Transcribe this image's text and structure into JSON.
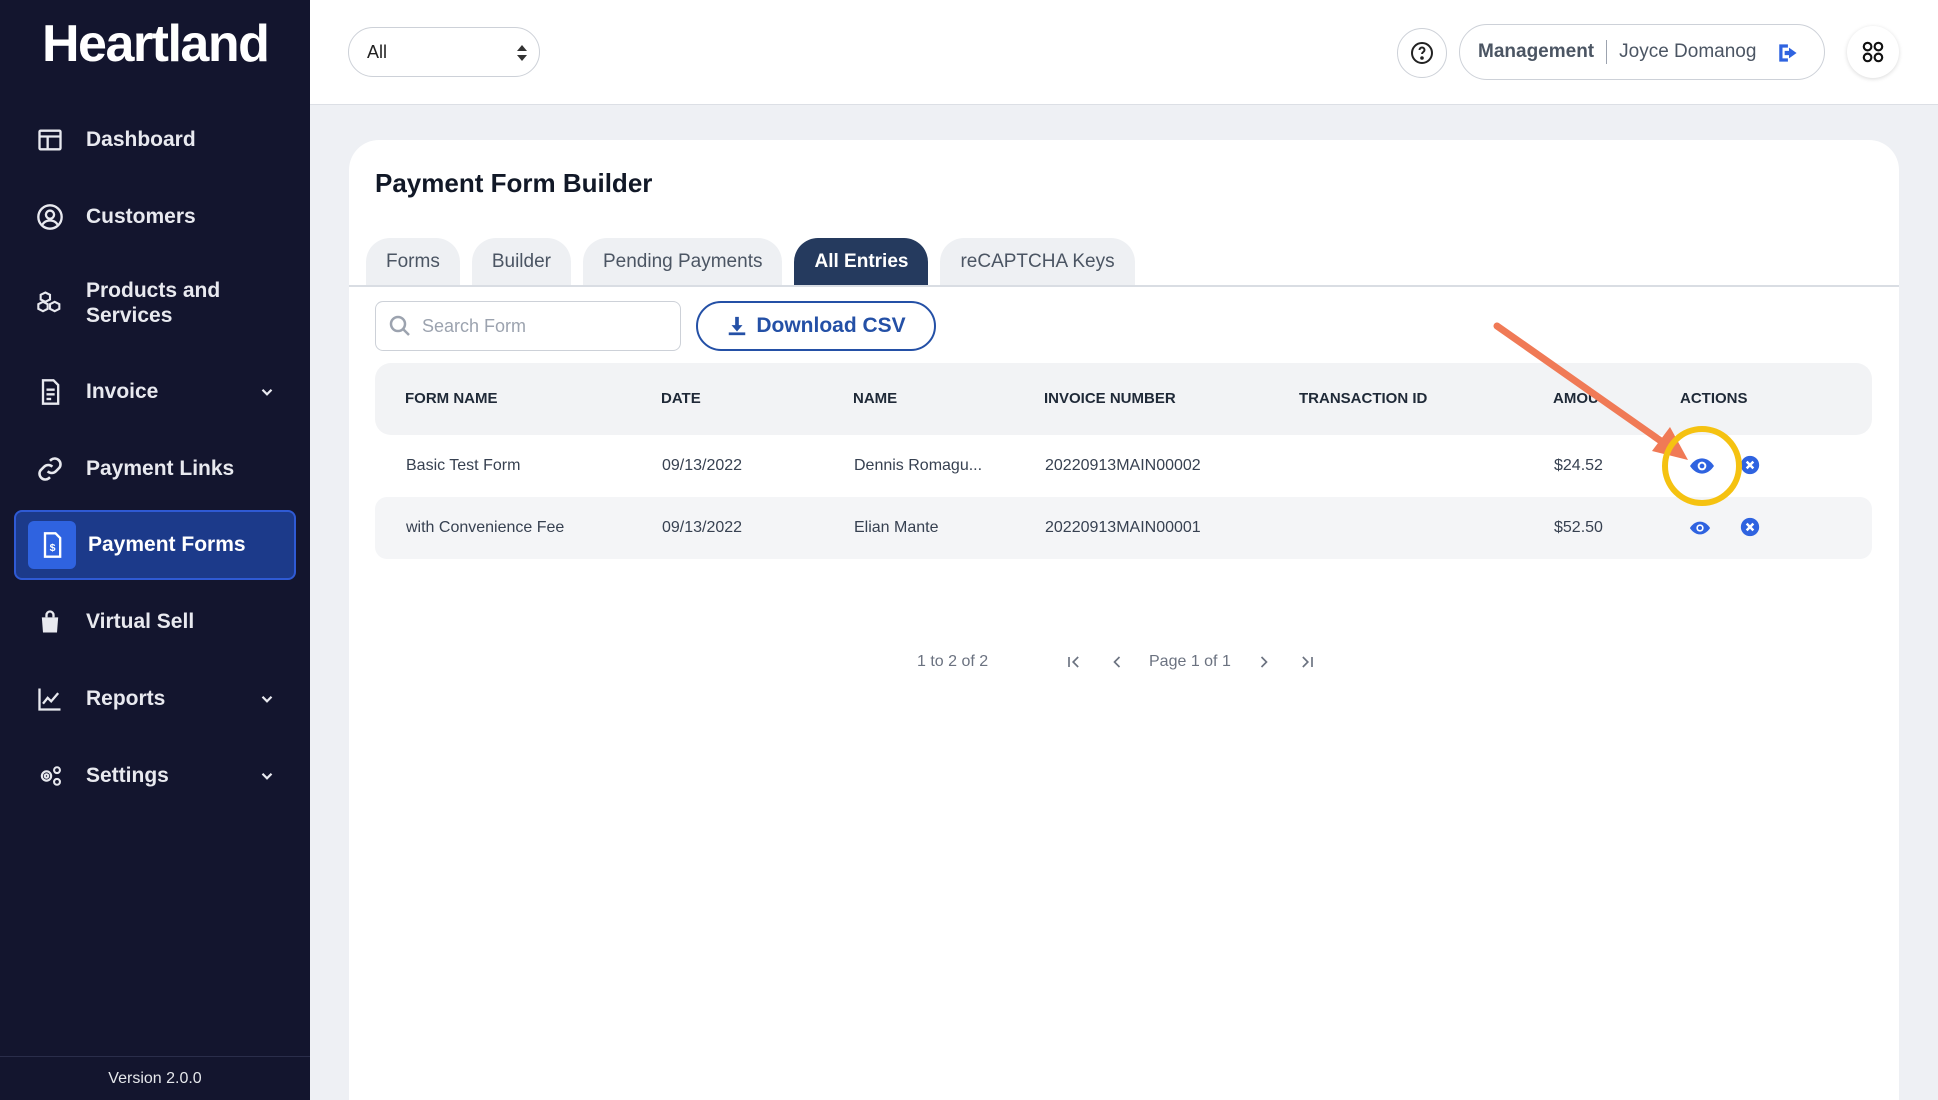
{
  "brand": "Heartland",
  "sidebar": {
    "items": [
      {
        "label": "Dashboard",
        "icon": "dashboard-icon"
      },
      {
        "label": "Customers",
        "icon": "user-circle-icon"
      },
      {
        "label": "Products and Services",
        "icon": "boxes-icon"
      },
      {
        "label": "Invoice",
        "icon": "invoice-icon"
      },
      {
        "label": "Payment Links",
        "icon": "link-icon"
      },
      {
        "label": "Payment Forms",
        "icon": "payment-form-icon"
      },
      {
        "label": "Virtual Sell",
        "icon": "shopping-bag-icon"
      },
      {
        "label": "Reports",
        "icon": "chart-line-icon"
      },
      {
        "label": "Settings",
        "icon": "gears-icon"
      }
    ],
    "version": "Version 2.0.0"
  },
  "topbar": {
    "filter_value": "All",
    "role": "Management",
    "user_name": "Joyce Domanog"
  },
  "page": {
    "title": "Payment Form Builder",
    "tabs": [
      "Forms",
      "Builder",
      "Pending Payments",
      "All Entries",
      "reCAPTCHA Keys"
    ],
    "active_tab": "All Entries",
    "search_placeholder": "Search Form",
    "download_label": "Download CSV"
  },
  "table": {
    "headers": [
      "FORM NAME",
      "DATE",
      "NAME",
      "INVOICE NUMBER",
      "TRANSACTION ID",
      "AMOU",
      "ACTIONS"
    ],
    "rows": [
      {
        "form_name": "Basic Test Form",
        "date": "09/13/2022",
        "name": "Dennis Romagu...",
        "invoice": "20220913MAIN00002",
        "transaction": "",
        "amount": "$24.52"
      },
      {
        "form_name": "with Convenience Fee",
        "date": "09/13/2022",
        "name": "Elian Mante",
        "invoice": "20220913MAIN00001",
        "transaction": "",
        "amount": "$52.50"
      }
    ]
  },
  "pager": {
    "info": "1 to 2 of 2",
    "page": "Page 1 of 1"
  },
  "colors": {
    "sidebar_bg": "#13152e",
    "active_nav": "#1c3a8a",
    "accent_blue": "#2450a6",
    "tab_active": "#253a5e",
    "annotation_arrow": "#f07a56",
    "annotation_circle": "#f5c211"
  }
}
